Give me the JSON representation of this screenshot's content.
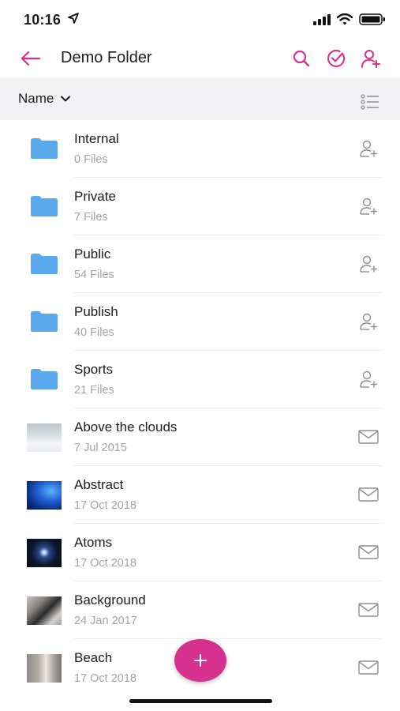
{
  "status_bar": {
    "time": "10:16"
  },
  "nav": {
    "title": "Demo Folder",
    "accent_color": "#d6318e",
    "actions": [
      "search-icon",
      "select-check-icon",
      "add-user-icon"
    ]
  },
  "sort": {
    "label": "Name"
  },
  "items": [
    {
      "kind": "folder",
      "name": "Internal",
      "meta": "0 Files",
      "action_icon": "share-user-icon"
    },
    {
      "kind": "folder",
      "name": "Private",
      "meta": "7 Files",
      "action_icon": "share-user-icon"
    },
    {
      "kind": "folder",
      "name": "Public",
      "meta": "54 Files",
      "action_icon": "share-user-icon"
    },
    {
      "kind": "folder",
      "name": "Publish",
      "meta": "40 Files",
      "action_icon": "share-user-icon"
    },
    {
      "kind": "folder",
      "name": "Sports",
      "meta": "21 Files",
      "action_icon": "share-user-icon"
    },
    {
      "kind": "image",
      "name": "Above the clouds",
      "meta": "7 Jul 2015",
      "action_icon": "mail-icon"
    },
    {
      "kind": "image",
      "name": "Abstract",
      "meta": "17 Oct 2018",
      "action_icon": "mail-icon"
    },
    {
      "kind": "image",
      "name": "Atoms",
      "meta": "17 Oct 2018",
      "action_icon": "mail-icon"
    },
    {
      "kind": "image",
      "name": "Background",
      "meta": "24 Jan 2017",
      "action_icon": "mail-icon"
    },
    {
      "kind": "image",
      "name": "Beach",
      "meta": "17 Oct 2018",
      "action_icon": "mail-icon"
    }
  ],
  "colors": {
    "folder": "#5aa9ec",
    "meta_text": "#a4a4a8",
    "icon_gray": "#8e8e93"
  }
}
